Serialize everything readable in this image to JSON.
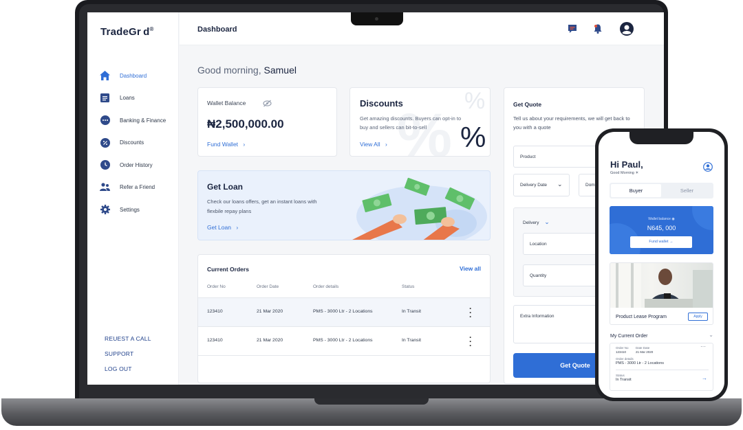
{
  "app": {
    "logo": "TradeGr d",
    "logo_mark": "®"
  },
  "sidebar": {
    "items": [
      {
        "label": "Dashboard",
        "icon": "home-icon",
        "active": true
      },
      {
        "label": "Loans",
        "icon": "document-icon"
      },
      {
        "label": "Banking & Finance",
        "icon": "more-dots-icon"
      },
      {
        "label": "Discounts",
        "icon": "percent-icon"
      },
      {
        "label": "Order History",
        "icon": "clock-icon"
      },
      {
        "label": "Refer a Friend",
        "icon": "users-icon"
      },
      {
        "label": "Settings",
        "icon": "gear-icon"
      }
    ],
    "links": [
      "REUEST A CALL",
      "SUPPORT",
      "LOG OUT"
    ]
  },
  "topbar": {
    "title": "Dashboard"
  },
  "greeting": {
    "prefix": "Good morning, ",
    "name": "Samuel"
  },
  "wallet": {
    "label": "Wallet Balance",
    "amount": "₦2,500,000.00",
    "action": "Fund Wallet"
  },
  "discounts": {
    "title": "Discounts",
    "text": "Get amazing discounts. Buyers can opt-in to buy and sellers can bit-to-sell",
    "action": "View All"
  },
  "loan": {
    "title": "Get Loan",
    "text": "Check our loans offers, get an instant loans with flexbile repay plans",
    "action": "Get Loan"
  },
  "orders": {
    "title": "Current Orders",
    "view_all": "View all",
    "columns": [
      "Order No",
      "Order Date",
      "Order details",
      "Status"
    ],
    "rows": [
      {
        "no": "123410",
        "date": "21 Mar 2020",
        "details": "PMS - 3000 Ltr - 2 Locations",
        "status": "In Transit"
      },
      {
        "no": "123410",
        "date": "21 Mar 2020",
        "details": "PMS - 3000 Ltr - 2 Locations",
        "status": "In Transit"
      }
    ]
  },
  "quote": {
    "title": "Get Quote",
    "text": "Tell us about your requirements, we will get back to you with a quote",
    "product": "Product",
    "delivery_date": "Delivery Date",
    "domestic": "Domest",
    "delivery": "Delivery",
    "location": "Location",
    "quantity": "Quantity",
    "extra": "Extra Information",
    "button": "Get Quote"
  },
  "phone": {
    "greeting": "Hi Paul,",
    "sub": "Good Morning ☀",
    "tabs": [
      "Buyer",
      "Seller"
    ],
    "wallet_label": "Wallet balance",
    "wallet_amount": "N645, 000",
    "fund": "Fund wallet →",
    "product": "Product Lease Program",
    "apply": "Apply",
    "current_order": "My Current Order",
    "order_no_label": "Order No",
    "order_no": "123410",
    "order_date_label": "Date Date",
    "order_date": "21 Mar 2020",
    "details_label": "Order details",
    "details": "PMS - 3000 Ltr - 2 Locations",
    "status_label": "Status",
    "status": "In Transit"
  },
  "colors": {
    "accent": "#2f6ed6",
    "navy": "#1b2540",
    "loan_bg": "#eaf1fc"
  }
}
